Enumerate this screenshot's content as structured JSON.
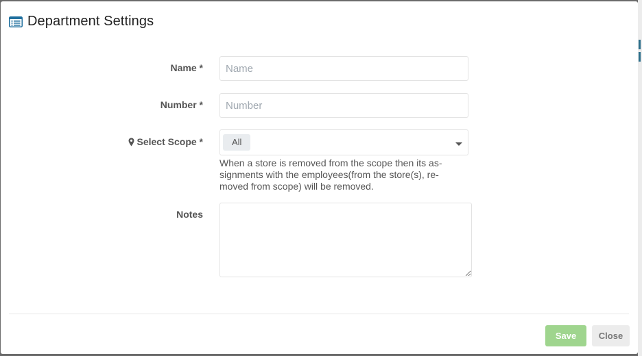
{
  "dialog": {
    "title": "Department Settings"
  },
  "form": {
    "name": {
      "label": "Name *",
      "value": "",
      "placeholder": "Name"
    },
    "number": {
      "label": "Number *",
      "value": "",
      "placeholder": "Number"
    },
    "scope": {
      "label": "Select Scope *",
      "selected": "All",
      "help": "When a store is removed from the scope then its as-signments with the employees(from the store(s), re-moved from scope) will be removed."
    },
    "notes": {
      "label": "Notes",
      "value": ""
    }
  },
  "footer": {
    "save_label": "Save",
    "close_label": "Close"
  },
  "colors": {
    "save_button": "#9fd58e",
    "close_button": "#ececec",
    "header_icon": "#1f6f9e"
  },
  "icons": {
    "header": "list-card-icon",
    "scope": "map-marker-icon",
    "dropdown": "caret-down-icon"
  }
}
